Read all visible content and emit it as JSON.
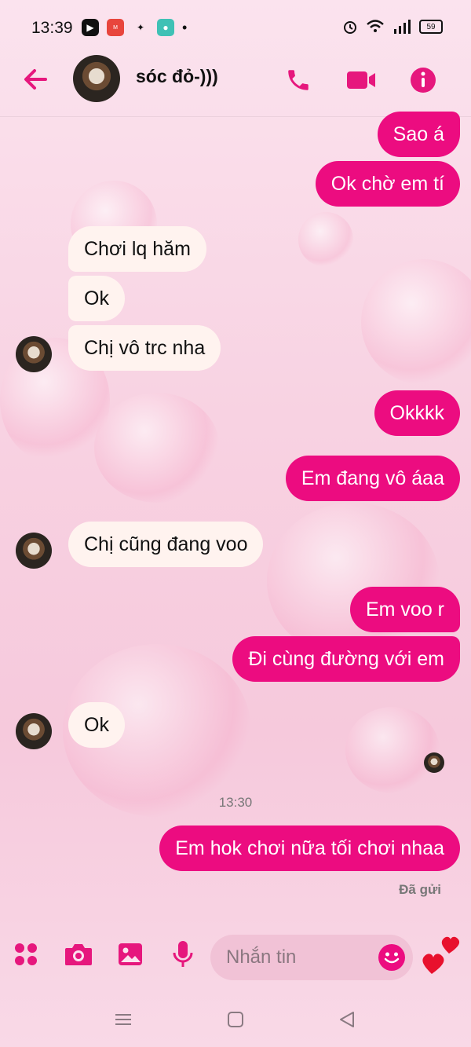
{
  "status": {
    "time": "13:39",
    "battery": "59"
  },
  "header": {
    "contact_name": "sóc đỏ-)))"
  },
  "messages": [
    {
      "text": "Sao á",
      "dir": "out"
    },
    {
      "text": "Ok chờ em tí",
      "dir": "out"
    },
    {
      "text": "Chơi lq hăm",
      "dir": "in"
    },
    {
      "text": "Ok",
      "dir": "in"
    },
    {
      "text": "Chị vô trc nha",
      "dir": "in"
    },
    {
      "text": "Okkkk",
      "dir": "out"
    },
    {
      "text": "Em đang vô áaa",
      "dir": "out"
    },
    {
      "text": "Chị cũng đang voo",
      "dir": "in"
    },
    {
      "text": "Em voo r",
      "dir": "out"
    },
    {
      "text": "Đi cùng đường với em",
      "dir": "out"
    },
    {
      "text": "Ok",
      "dir": "in"
    },
    {
      "text": "Em hok chơi nữa tối chơi nhaa",
      "dir": "out"
    }
  ],
  "timestamp": "13:30",
  "sent_status": "Đã gửi",
  "composer": {
    "placeholder": "Nhắn tin"
  },
  "colors": {
    "accent": "#ec0c80",
    "incoming": "#fff3ef"
  },
  "icons": [
    "back-arrow-icon",
    "phone-icon",
    "video-icon",
    "info-icon",
    "menu-dots-icon",
    "camera-icon",
    "image-icon",
    "mic-icon",
    "emoji-icon",
    "hearts-icon"
  ]
}
